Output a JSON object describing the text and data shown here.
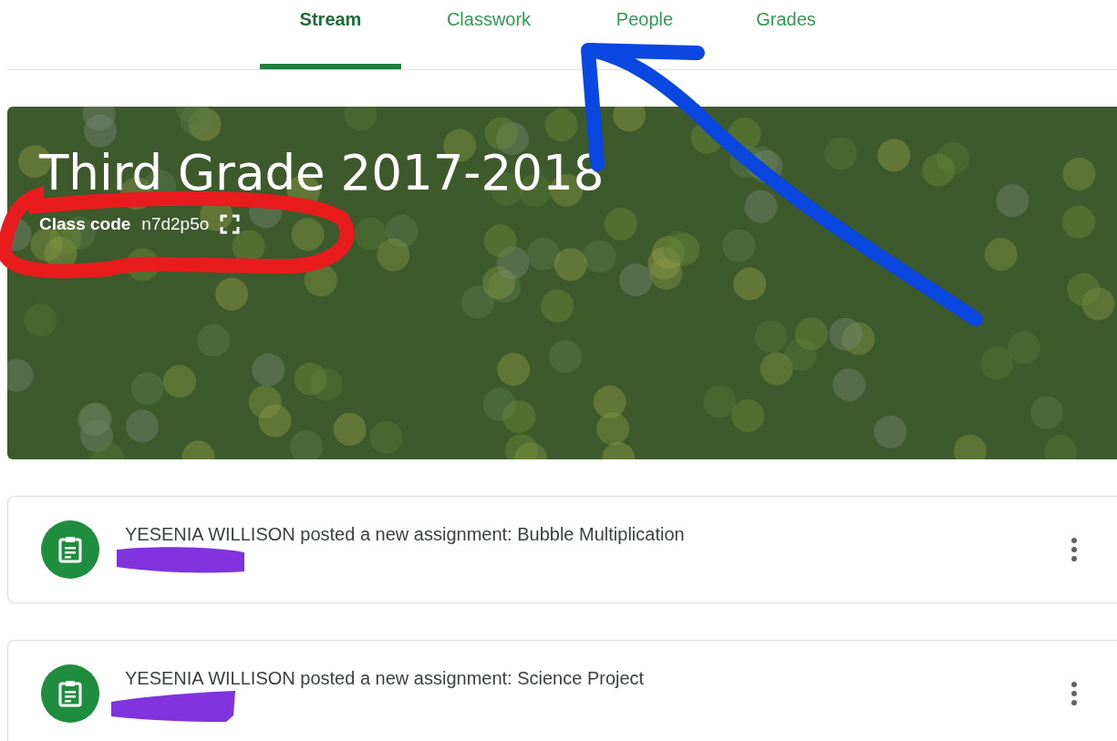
{
  "tabs": [
    {
      "label": "Stream",
      "selected": true
    },
    {
      "label": "Classwork",
      "selected": false
    },
    {
      "label": "People",
      "selected": false
    },
    {
      "label": "Grades",
      "selected": false
    }
  ],
  "banner": {
    "title": "Third Grade 2017-2018",
    "code_label": "Class code",
    "code": "n7d2p5o"
  },
  "posts": [
    {
      "text": "YESENIA WILLISON posted a new assignment: Bubble Multiplication"
    },
    {
      "text": "YESENIA WILLISON posted a new assignment: Science Project"
    }
  ]
}
